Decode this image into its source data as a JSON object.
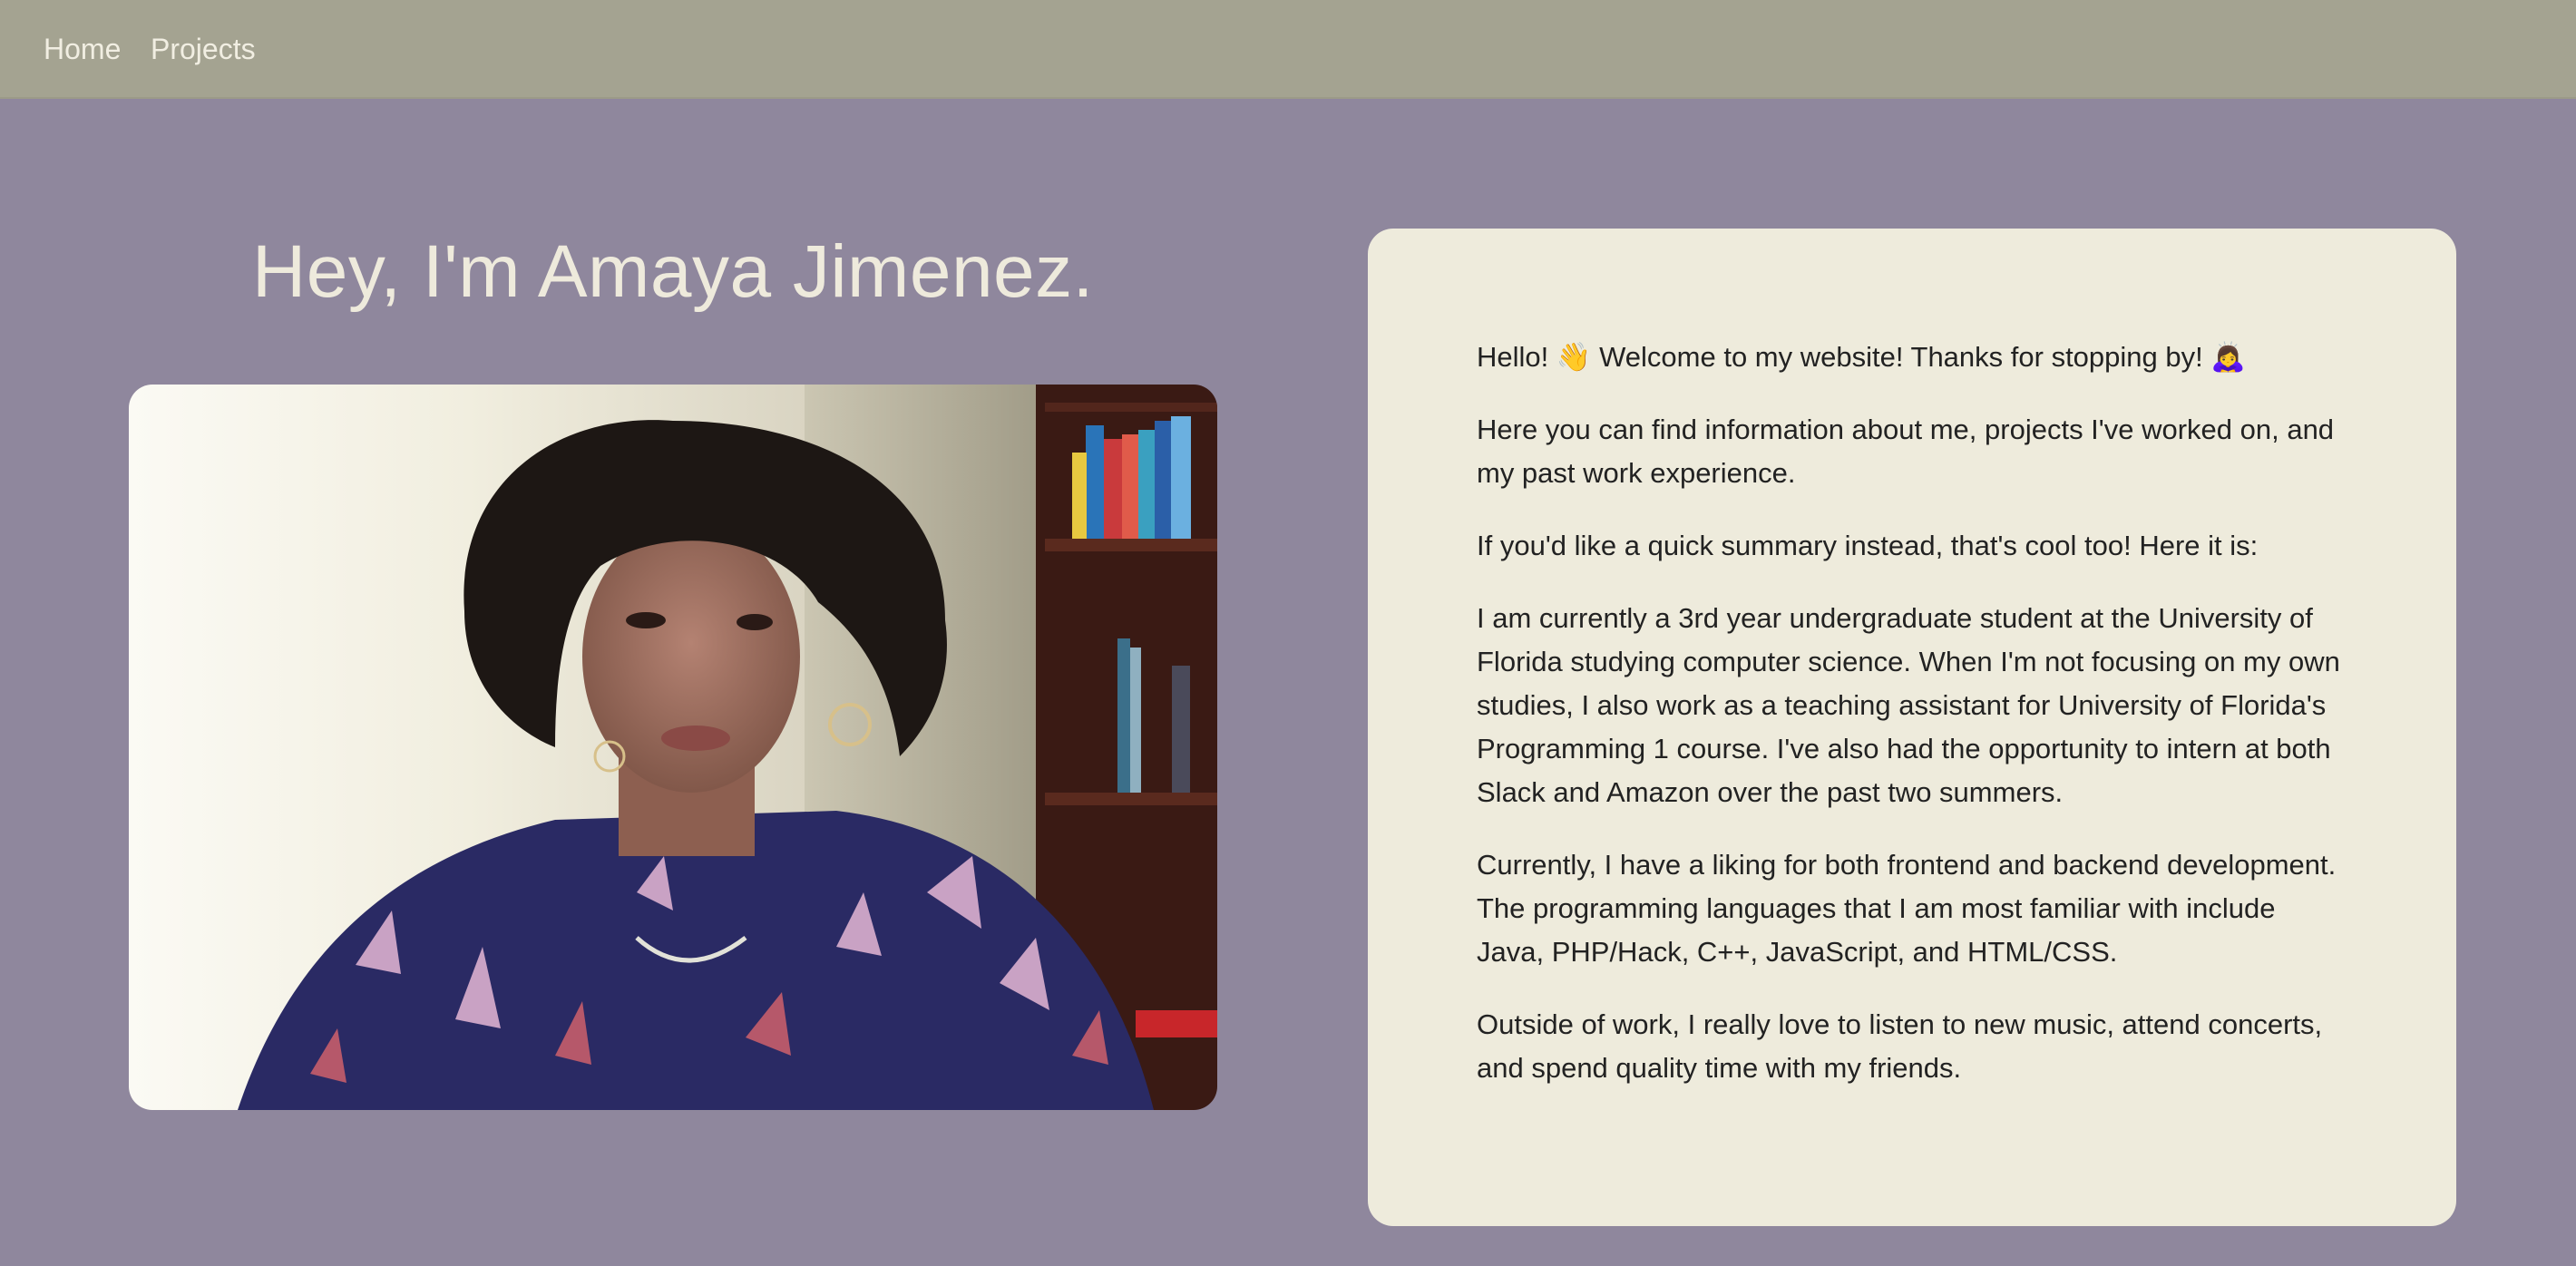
{
  "nav": {
    "home_label": "Home",
    "projects_label": "Projects"
  },
  "hero": {
    "title": "Hey, I'm Amaya Jimenez."
  },
  "about": {
    "greeting_text": "Hello! 👋 Welcome to my website! Thanks for stopping by! 🙇‍♀️",
    "paragraphs": [
      "Here you can find information about me, projects I've worked on, and my past work experience.",
      "If you'd like a quick summary instead, that's cool too! Here it is:",
      "I am currently a 3rd year undergraduate student at the University of Florida studying computer science. When I'm not focusing on my own studies, I also work as a teaching assistant for University of Florida's Programming 1 course. I've also had the opportunity to intern at both Slack and Amazon over the past two summers.",
      "Currently, I have a liking for both frontend and backend development. The programming languages that I am most familiar with include Java, PHP/Hack, C++, JavaScript, and HTML/CSS.",
      "Outside of work, I really love to listen to new music, attend concerts, and spend quality time with my friends."
    ]
  },
  "colors": {
    "page_background": "#8f879d",
    "navbar_background": "#a4a391",
    "card_background": "#eeebdc",
    "title_text": "#eeeadc",
    "body_text": "#222222"
  },
  "icons": {
    "greeting_wave": "waving-hand-icon",
    "greeting_bow": "person-bowing-icon"
  }
}
